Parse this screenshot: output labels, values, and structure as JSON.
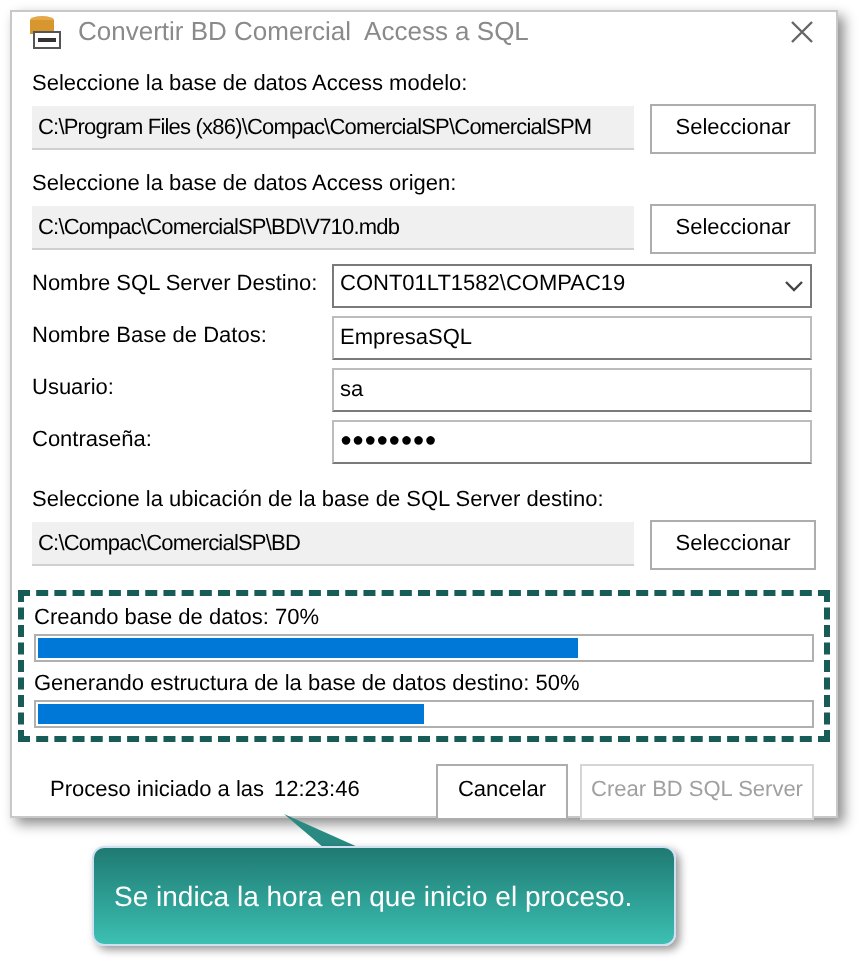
{
  "window": {
    "title": "Convertir BD Comercial  Access a SQL"
  },
  "sources": [
    {
      "label": "Seleccione la base de datos Access modelo:",
      "value": "C:\\Program Files (x86)\\Compac\\ComercialSP\\ComercialSPM",
      "button": "Seleccionar"
    },
    {
      "label": "Seleccione la base de datos Access origen:",
      "value": "C:\\Compac\\ComercialSP\\BD\\V710.mdb",
      "button": "Seleccionar"
    }
  ],
  "form": [
    {
      "kind": "dropdown",
      "label": "Nombre SQL Server Destino:",
      "value": "CONT01LT1582\\COMPAC19"
    },
    {
      "kind": "text",
      "label": "Nombre Base de Datos:",
      "value": "EmpresaSQL"
    },
    {
      "kind": "text",
      "label": "Usuario:",
      "value": "sa"
    },
    {
      "kind": "password",
      "label": "Contraseña:",
      "value": "●●●●●●●●"
    }
  ],
  "destination": {
    "label": "Seleccione la ubicación de la base de SQL Server destino:",
    "value": "C:\\Compac\\ComercialSP\\BD",
    "button": "Seleccionar"
  },
  "progress": [
    {
      "label": "Creando base de datos: 70%",
      "level": 0.7
    },
    {
      "label": "Generando estructura de la base de datos destino: 50%",
      "level": 0.5
    }
  ],
  "status": {
    "label": "Proceso iniciado a las",
    "time": "12:23:46"
  },
  "buttons": [
    {
      "label": "Cancelar",
      "disabled": false
    },
    {
      "label": "Crear BD SQL Server",
      "disabled": true
    }
  ],
  "callout": {
    "text": "Se indica la hora en que inicio el proceso."
  }
}
